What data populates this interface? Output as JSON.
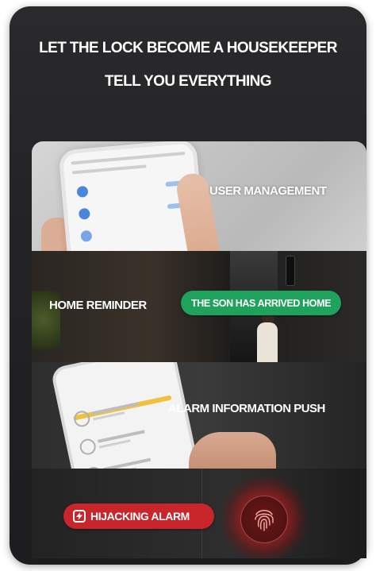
{
  "header": {
    "line1": "LET THE LOCK BECOME A HOUSEKEEPER",
    "line2": "TELL YOU EVERYTHING"
  },
  "features": {
    "user_management": "USER MANAGEMENT",
    "home_reminder": "HOME REMINDER",
    "son_arrived_badge": "THE SON HAS ARRIVED HOME",
    "alarm_push": "ALARM INFORMATION PUSH",
    "hijacking_badge": "HIJACKING ALARM"
  },
  "colors": {
    "background": "#1f1f21",
    "green_badge": "#1fa25c",
    "red_badge": "#c8262b",
    "fingerprint_glow": "#c42828"
  },
  "icons": {
    "hijacking_badge_icon": "lightning-bolt-icon",
    "fingerprint_sensor": "fingerprint-icon"
  }
}
